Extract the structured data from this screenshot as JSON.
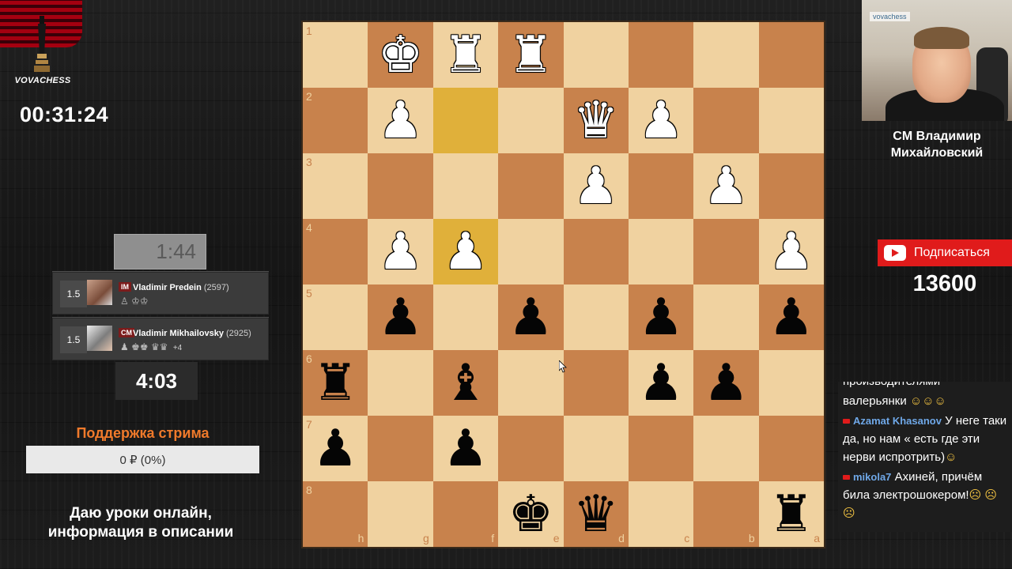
{
  "brand": {
    "logo_text": "VOVACHESS",
    "watermark": "vovachess"
  },
  "stream_timer": "00:31:24",
  "clocks": {
    "top": "1:44",
    "bottom": "4:03"
  },
  "players": [
    {
      "score": "1.5",
      "title": "IM",
      "name": "Vladimir Predein",
      "rating": "(2597)",
      "icons": "♙ ♔♔",
      "extra": ""
    },
    {
      "score": "1.5",
      "title": "CM",
      "name": "Vladimir Mikhailovsky",
      "rating": "(2925)",
      "icons": "♟ ♚♚ ♛♛",
      "extra": "+4"
    }
  ],
  "support": {
    "title": "Поддержка стрима",
    "amount": "0 ₽ (0%)"
  },
  "lessons": {
    "line1": "Даю уроки онлайн,",
    "line2": "информация в описании"
  },
  "streamer": {
    "line1": "CM Владимир",
    "line2": "Михайловский"
  },
  "subscribe": {
    "label": "Подписаться",
    "count": "13600"
  },
  "chat": [
    {
      "author": "",
      "text": "производителями",
      "emoji": "",
      "clipped": true
    },
    {
      "author": "",
      "text": "валерьянки",
      "emoji": " ☺☺☺",
      "clipped": false
    },
    {
      "author": "Azamat Khasanov",
      "text": "У неге таки да, но нам « есть где эти нерви испротрить)",
      "emoji": "☺",
      "clipped": false
    },
    {
      "author": "mikola7",
      "text": "Ахиней, причём била электрошокером!",
      "emoji": "☹ ☹☹",
      "clipped": false
    }
  ],
  "board": {
    "ranks": [
      "1",
      "2",
      "3",
      "4",
      "5",
      "6",
      "7",
      "8"
    ],
    "files": [
      "h",
      "g",
      "f",
      "e",
      "d",
      "c",
      "b",
      "a"
    ],
    "highlights": [
      "1-2",
      "3-2"
    ],
    "colors": {
      "light": "#f0d2a0",
      "dark": "#c8824c",
      "highlight": "#e0b03a"
    },
    "rows": [
      [
        "",
        "wK",
        "wR",
        "wR",
        "",
        "",
        "",
        ""
      ],
      [
        "",
        "wP",
        "",
        "",
        "wQ",
        "wP",
        "",
        ""
      ],
      [
        "",
        "",
        "",
        "",
        "wP",
        "",
        "wP",
        ""
      ],
      [
        "",
        "wP",
        "wP",
        "",
        "",
        "",
        "",
        "wP"
      ],
      [
        "",
        "bP",
        "",
        "bP",
        "",
        "bP",
        "",
        "bP"
      ],
      [
        "bR",
        "",
        "bB",
        "",
        "",
        "bP",
        "bP",
        ""
      ],
      [
        "bP",
        "",
        "bP",
        "",
        "",
        "",
        "",
        ""
      ],
      [
        "",
        "",
        "",
        "bK",
        "bQ",
        "",
        "",
        "bR"
      ]
    ]
  }
}
